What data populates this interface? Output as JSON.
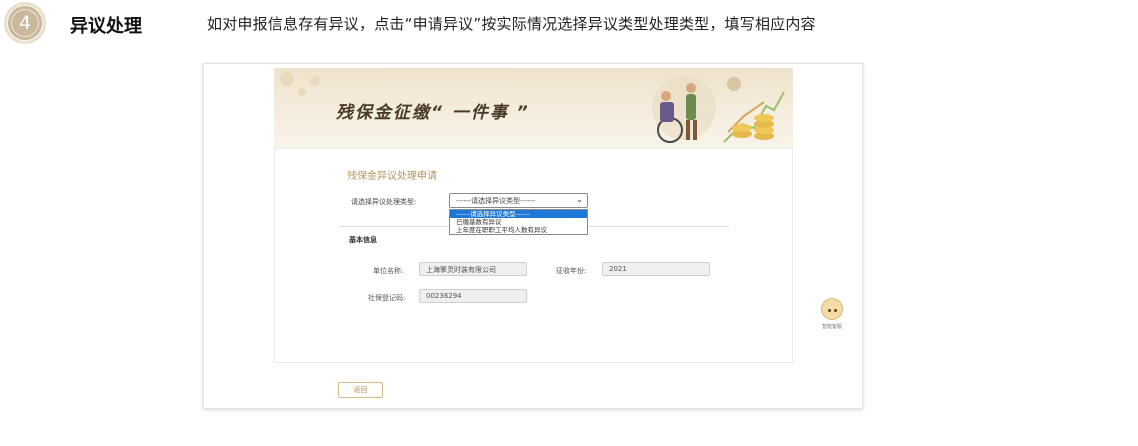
{
  "step": {
    "number": "4",
    "title": "异议处理",
    "description": "如对申报信息存有异议，点击“申请异议”按实际情况选择异议类型处理类型，填写相应内容"
  },
  "banner": {
    "title": "残保金征缴“ 一件事 ”"
  },
  "form": {
    "title": "残保金异议处理申请",
    "type_label": "请选择异议处理类型:",
    "type_selected": "------请选择异议类型------",
    "type_options": [
      "------请选择异议类型------",
      "已缴基数有异议",
      "上年度在职职工平均人数有异议"
    ],
    "section_title": "基本信息",
    "fields": {
      "company_label": "单位名称:",
      "company_value": "上海擎灵时装有限公司",
      "year_label": "征收年份:",
      "year_value": "2021",
      "social_label": "社保登记码:",
      "social_value": "00236294"
    },
    "back_button": "返回"
  },
  "assistant": {
    "label": "智能客服"
  },
  "colors": {
    "accent": "#b8935c",
    "badge": "#c9b89b",
    "selected_option": "#1e78d7"
  }
}
